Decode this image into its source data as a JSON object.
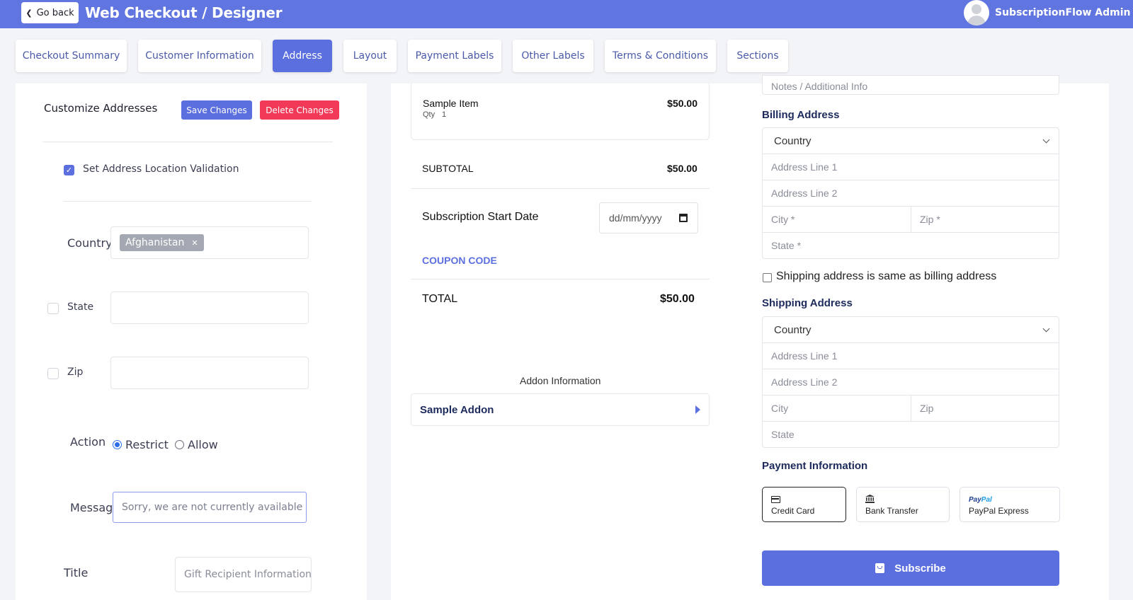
{
  "header": {
    "back_label": "Go back",
    "title": "Web Checkout / Designer",
    "user_name": "SubscriptionFlow Admin"
  },
  "tabs": [
    {
      "label": "Checkout Summary"
    },
    {
      "label": "Customer Information"
    },
    {
      "label": "Address",
      "active": true
    },
    {
      "label": "Layout"
    },
    {
      "label": "Payment Labels"
    },
    {
      "label": "Other Labels"
    },
    {
      "label": "Terms & Conditions"
    },
    {
      "label": "Sections"
    }
  ],
  "left": {
    "title": "Customize Addresses",
    "save_label": "Save Changes",
    "delete_label": "Delete Changes",
    "validation_label": "Set Address Location Validation",
    "validation_checked": true,
    "country_label": "Country",
    "country_chip": "Afghanistan",
    "state_label": "State",
    "zip_label": "Zip",
    "action_label": "Action",
    "restrict_label": "Restrict",
    "allow_label": "Allow",
    "action_value": "Restrict",
    "message_label": "Message",
    "message_value": "Sorry, we are not currently available in",
    "title_label": "Title",
    "title_value": "Gift Recipient Information"
  },
  "middle": {
    "item_name": "Sample Item",
    "item_qty_label": "Qty",
    "item_qty": "1",
    "item_price": "$50.00",
    "subtotal_label": "SUBTOTAL",
    "subtotal_value": "$50.00",
    "start_date_label": "Subscription Start Date",
    "start_date_placeholder": "dd/mm/yyyy",
    "coupon_label": "COUPON CODE",
    "total_label": "TOTAL",
    "total_value": "$50.00",
    "addon_heading": "Addon Information",
    "addon_name": "Sample Addon"
  },
  "right": {
    "notes_placeholder": "Notes / Additional Info",
    "billing_heading": "Billing Address",
    "billing": {
      "country": "Country",
      "line1": "Address Line 1",
      "line2": "Address Line 2",
      "city": "City *",
      "zip": "Zip *",
      "state": "State *"
    },
    "same_as_billing_label": "Shipping address is same as billing address",
    "shipping_heading": "Shipping Address",
    "shipping": {
      "country": "Country",
      "line1": "Address Line 1",
      "line2": "Address Line 2",
      "city": "City",
      "zip": "Zip",
      "state": "State"
    },
    "payment_heading": "Payment Information",
    "payment_methods": [
      {
        "label": "Credit Card",
        "icon": "credit-card-icon",
        "selected": true
      },
      {
        "label": "Bank Transfer",
        "icon": "bank-icon"
      },
      {
        "label": "PayPal Express",
        "icon": "paypal-logo"
      }
    ],
    "paypal_logo_text_1": "Pay",
    "paypal_logo_text_2": "Pal",
    "subscribe_label": "Subscribe"
  },
  "colors": {
    "brand": "#6075e0",
    "primary_button": "#5c6fde",
    "danger_button": "#f23a58"
  }
}
